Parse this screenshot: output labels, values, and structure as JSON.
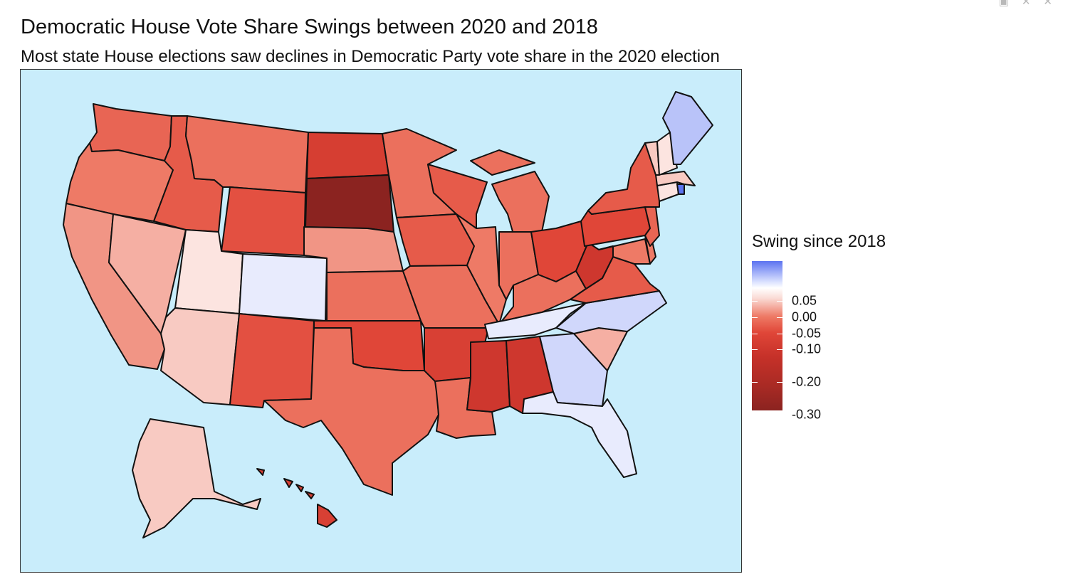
{
  "window": {
    "controls": [
      "minimize-icon",
      "close-icon",
      "close-icon"
    ]
  },
  "map": {
    "title": "Democratic House Vote Share Swings between 2020 and 2018",
    "subtitle": "Most state House elections saw declines in Democratic Party vote share in the 2020 election",
    "background": "#c9edfb",
    "colors": {
      "positive": "#5c73f0",
      "zero": "#ffffff",
      "negative_mid": "#e04638",
      "negative_max": "#8b2320"
    },
    "legend": {
      "title": "Swing since 2018",
      "ticks": [
        "0.05",
        "0.00",
        "-0.05",
        "-0.10",
        "-0.20",
        "-0.30"
      ]
    },
    "states": [
      {
        "name": "WA",
        "swing": -0.07
      },
      {
        "name": "OR",
        "swing": -0.05
      },
      {
        "name": "CA",
        "swing": -0.04
      },
      {
        "name": "NV",
        "swing": -0.03
      },
      {
        "name": "ID",
        "swing": -0.08
      },
      {
        "name": "MT",
        "swing": -0.06
      },
      {
        "name": "WY",
        "swing": -0.09
      },
      {
        "name": "UT",
        "swing": -0.01
      },
      {
        "name": "AZ",
        "swing": -0.02
      },
      {
        "name": "CO",
        "swing": 0.01
      },
      {
        "name": "NM",
        "swing": -0.09
      },
      {
        "name": "ND",
        "swing": -0.14
      },
      {
        "name": "SD",
        "swing": -0.33
      },
      {
        "name": "NE",
        "swing": -0.04
      },
      {
        "name": "KS",
        "swing": -0.06
      },
      {
        "name": "OK",
        "swing": -0.1
      },
      {
        "name": "TX",
        "swing": -0.06
      },
      {
        "name": "MN",
        "swing": -0.06
      },
      {
        "name": "IA",
        "swing": -0.08
      },
      {
        "name": "MO",
        "swing": -0.06
      },
      {
        "name": "AR",
        "swing": -0.13
      },
      {
        "name": "LA",
        "swing": -0.06
      },
      {
        "name": "WI",
        "swing": -0.08
      },
      {
        "name": "IL",
        "swing": -0.05
      },
      {
        "name": "MI",
        "swing": -0.06
      },
      {
        "name": "IN",
        "swing": -0.06
      },
      {
        "name": "OH",
        "swing": -0.1
      },
      {
        "name": "KY",
        "swing": -0.06
      },
      {
        "name": "TN",
        "swing": 0.01
      },
      {
        "name": "MS",
        "swing": -0.17
      },
      {
        "name": "AL",
        "swing": -0.17
      },
      {
        "name": "GA",
        "swing": 0.02
      },
      {
        "name": "FL",
        "swing": 0.01
      },
      {
        "name": "SC",
        "swing": -0.03
      },
      {
        "name": "NC",
        "swing": 0.02
      },
      {
        "name": "VA",
        "swing": -0.08
      },
      {
        "name": "WV",
        "swing": -0.17
      },
      {
        "name": "PA",
        "swing": -0.1
      },
      {
        "name": "NY",
        "swing": -0.08
      },
      {
        "name": "MD",
        "swing": -0.05
      },
      {
        "name": "DE",
        "swing": -0.05
      },
      {
        "name": "NJ",
        "swing": -0.07
      },
      {
        "name": "CT",
        "swing": -0.01
      },
      {
        "name": "RI",
        "swing": 0.07
      },
      {
        "name": "MA",
        "swing": -0.02
      },
      {
        "name": "VT",
        "swing": -0.02
      },
      {
        "name": "NH",
        "swing": -0.01
      },
      {
        "name": "ME",
        "swing": 0.03
      },
      {
        "name": "AK",
        "swing": -0.02
      },
      {
        "name": "HI",
        "swing": -0.13
      }
    ]
  }
}
